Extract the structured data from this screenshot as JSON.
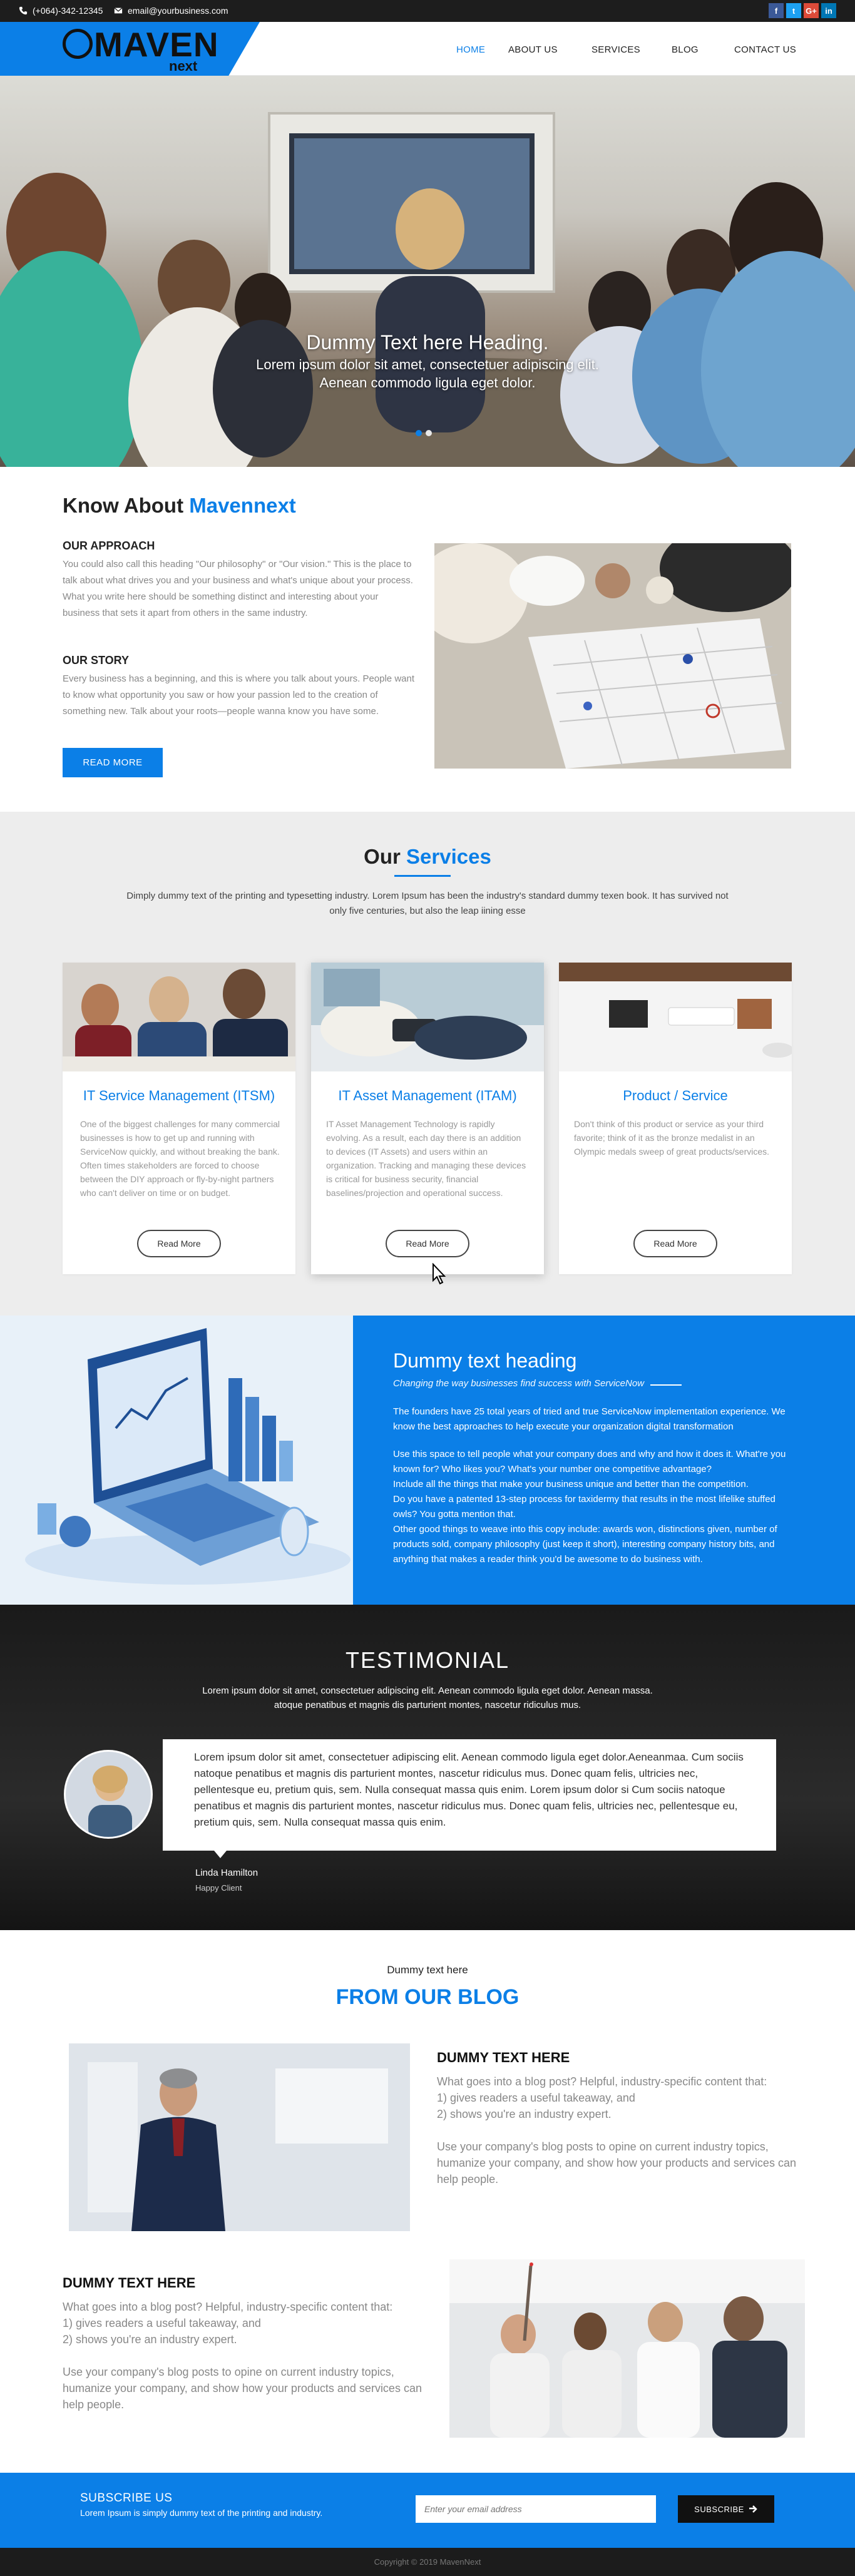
{
  "topbar": {
    "phone": "(+064)-342-12345",
    "email": "email@yourbusiness.com",
    "social": [
      {
        "name": "facebook-icon",
        "glyph": "f",
        "color": "#3b5998"
      },
      {
        "name": "twitter-icon",
        "glyph": "t",
        "color": "#1da1f2"
      },
      {
        "name": "google-plus-icon",
        "glyph": "G+",
        "color": "#dd4b39"
      },
      {
        "name": "linkedin-icon",
        "glyph": "in",
        "color": "#0077b5"
      }
    ]
  },
  "logo": {
    "word": "MAVEN",
    "sub": "next"
  },
  "nav": [
    "HOME",
    "ABOUT US",
    "SERVICES",
    "BLOG",
    "CONTACT US"
  ],
  "hero": {
    "heading": "Dummy Text here Heading.",
    "line1": "Lorem ipsum dolor sit amet, consectetuer adipiscing elit.",
    "line2": "Aenean commodo ligula eget dolor."
  },
  "about": {
    "title_plain": "Know About ",
    "title_accent": "Mavennext",
    "approach_title": "OUR APPROACH",
    "approach_text": "You could also call this heading \"Our philosophy\" or \"Our vision.\" This is the place to talk about what drives you and your business and what's unique about your process. What you write here should be something distinct and interesting about your business that sets it apart from others in the same industry.",
    "story_title": "OUR STORY",
    "story_text": "Every business has a beginning, and this is where you talk about yours. People want to know what opportunity you saw or how your passion led to the creation of something new. Talk about your roots—people wanna know you have some.",
    "button": "READ MORE"
  },
  "services": {
    "title_plain": "Our ",
    "title_accent": "Services",
    "intro": "Dimply dummy text of the printing and typesetting industry. Lorem Ipsum has been the industry's standard dummy texen book. It has survived not only five centuries, but also the leap iining esse",
    "cards": [
      {
        "title": "IT Service Management (ITSM)",
        "text": "One of the biggest challenges for many commercial businesses is how to get up and running with ServiceNow quickly, and without breaking the bank. Often times stakeholders are forced to choose between the DIY approach or fly-by-night partners who can't deliver on time or on budget.",
        "button": "Read More"
      },
      {
        "title": "IT Asset Management (ITAM)",
        "text": "IT Asset Management Technology is rapidly evolving. As a result, each day there is an addition to devices (IT Assets) and users within an organization. Tracking and managing these devices is critical for business security, financial baselines/projection and operational success.",
        "button": "Read More"
      },
      {
        "title": "Product / Service",
        "text": "Don't think of this product or service as your third favorite; think of it as the bronze medalist in an Olympic medals sweep of great products/services.",
        "button": "Read More"
      }
    ]
  },
  "feature": {
    "heading": "Dummy text heading",
    "subheading": "Changing the way businesses find success with ServiceNow",
    "p1": "The founders have 25 total years of tried and true ServiceNow implementation experience. We know the best approaches to help execute your organization digital transformation",
    "p2": "Use this space to tell people what your company does and why and how it does it. What're you known for? Who likes you? What's your number one competitive advantage?",
    "p3": "Include all the things that make your business unique and better than the competition.",
    "p4": "Do you have a patented 13-step process for taxidermy that results in the most lifelike stuffed owls? You gotta mention that.",
    "p5": "Other good things to weave into this copy include: awards won, distinctions given, number of products sold, company philosophy (just keep it short), interesting company history bits, and anything that makes a reader think you'd be awesome to do business with."
  },
  "testimonial": {
    "title": "TESTIMONIAL",
    "intro1": "Lorem ipsum dolor sit amet, consectetuer adipiscing elit. Aenean commodo ligula eget dolor. Aenean massa.",
    "intro2": "atoque penatibus et magnis dis parturient montes, nascetur ridiculus mus.",
    "quote": "Lorem ipsum dolor sit amet, consectetuer adipiscing elit. Aenean commodo ligula eget dolor.Aeneanmaa. Cum sociis natoque penatibus et magnis dis parturient montes, nascetur ridiculus mus. Donec quam felis, ultricies nec, pellentesque eu, pretium quis, sem. Nulla consequat massa quis enim. Lorem ipsum dolor si Cum sociis natoque penatibus et magnis dis parturient montes, nascetur ridiculus mus. Donec quam felis, ultricies nec, pellentesque eu, pretium quis, sem. Nulla consequat massa quis enim.",
    "name": "Linda Hamilton",
    "role": "Happy Client"
  },
  "blog": {
    "kicker": "Dummy text here",
    "title": "FROM OUR BLOG",
    "post1_title": "DUMMY TEXT HERE",
    "post2_title": "DUMMY TEXT HERE",
    "p_intro": "What goes into a blog post? Helpful, industry-specific content that:",
    "p_l1": "1) gives readers a useful takeaway, and",
    "p_l2": "2) shows you're an industry expert.",
    "p_more": "Use your company's blog posts to opine on current industry topics, humanize your company, and show how your products and services can help people."
  },
  "subscribe": {
    "title": "SUBSCRIBE US",
    "text": "Lorem Ipsum is simply dummy text of the printing and industry.",
    "placeholder": "Enter your email address",
    "button": "SUBSCRIBE"
  },
  "footer": {
    "copyright": "Copyright © 2019 MavenNext"
  }
}
